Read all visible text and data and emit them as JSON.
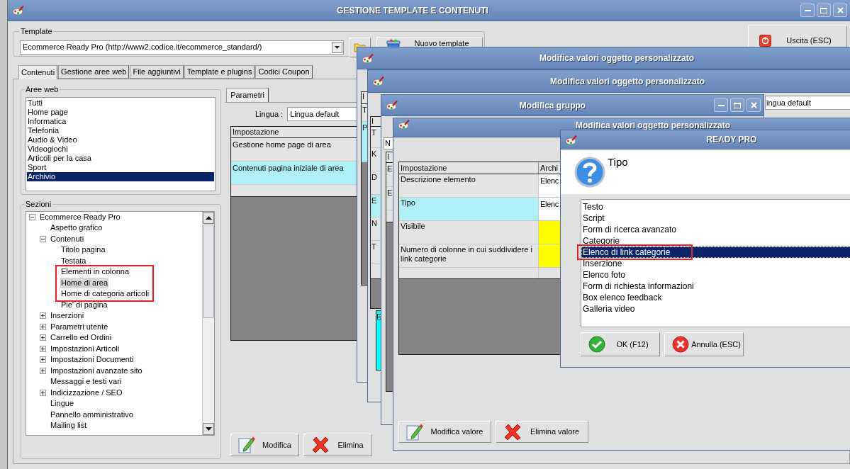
{
  "main_window": {
    "title": "GESTIONE TEMPLATE E CONTENUTI",
    "template": {
      "label": "Template",
      "value": "Ecommerce Ready Pro (http://www2.codice.it/ecommerce_standard/)"
    },
    "new_template_button": "Nuovo template",
    "exit_button": "Uscita (ESC)",
    "tabs": [
      {
        "label": "Contenuti",
        "selected": true
      },
      {
        "label": "Gestione aree web",
        "selected": false
      },
      {
        "label": "File aggiuntivi",
        "selected": false
      },
      {
        "label": "Template e plugins",
        "selected": false
      },
      {
        "label": "Codici Coupon",
        "selected": false
      }
    ],
    "aree_web": {
      "label": "Aree web",
      "items": [
        {
          "label": "Tutti",
          "selected": false
        },
        {
          "label": "Home page",
          "selected": false
        },
        {
          "label": "Informatica",
          "selected": false
        },
        {
          "label": "Telefonia",
          "selected": false
        },
        {
          "label": "Audio & Video",
          "selected": false
        },
        {
          "label": "Videogiochi",
          "selected": false
        },
        {
          "label": "Articoli per la casa",
          "selected": false
        },
        {
          "label": "Sport",
          "selected": false
        },
        {
          "label": "Archivio",
          "selected": true
        }
      ]
    },
    "sezioni": {
      "label": "Sezioni",
      "tree": [
        {
          "label": "Ecommerce Ready Pro",
          "expanded": true,
          "selected": false,
          "children": [
            {
              "label": "Aspetto grafico",
              "selected": false
            },
            {
              "label": "Contenuti",
              "expanded": true,
              "selected": false,
              "children": [
                {
                  "label": "Titolo pagina",
                  "selected": false
                },
                {
                  "label": "Testata",
                  "selected": false
                },
                {
                  "label": "Elementi in colonna",
                  "selected": false,
                  "marked": true
                },
                {
                  "label": "Home di area",
                  "selected": true,
                  "marked": true
                },
                {
                  "label": "Home di categoria articoli",
                  "selected": false,
                  "marked": true
                },
                {
                  "label": "Pie' di pagina",
                  "selected": false
                }
              ]
            },
            {
              "label": "Inserzioni",
              "expanded": false,
              "selected": false
            },
            {
              "label": "Parametri utente",
              "expanded": false,
              "selected": false
            },
            {
              "label": "Carrello ed Ordini",
              "expanded": false,
              "selected": false
            },
            {
              "label": "Impostazioni Articoli",
              "expanded": false,
              "selected": false
            },
            {
              "label": "Impostazioni Documenti",
              "expanded": false,
              "selected": false
            },
            {
              "label": "Impostazioni avanzate sito",
              "expanded": false,
              "selected": false
            },
            {
              "label": "Messaggi e testi vari",
              "selected": false
            },
            {
              "label": "Indicizzazione / SEO",
              "expanded": false,
              "selected": false
            },
            {
              "label": "Lingue",
              "selected": false
            },
            {
              "label": "Pannello amministrativo",
              "selected": false
            },
            {
              "label": "Mailing list",
              "selected": false
            }
          ]
        }
      ]
    },
    "parametri": {
      "tab": "Parametri",
      "lingua_label": "Lingua :",
      "lingua_value": "Lingua default",
      "column": "Impostazione",
      "rows": [
        {
          "label": "Gestione home page di area",
          "selected": false
        },
        {
          "label": "Contenuti pagina iniziale di area",
          "selected": true
        }
      ]
    },
    "buttons": [
      {
        "label": "Modifica",
        "kind": "edit"
      },
      {
        "label": "Elimina",
        "kind": "delete"
      }
    ]
  },
  "windows": [
    {
      "kind": "peek",
      "title": "Modifica valori oggetto personalizzato",
      "header": "I",
      "rows": [
        {
          "text": "T",
          "selected": false
        },
        {
          "text": "P",
          "selected": true
        }
      ]
    },
    {
      "kind": "peek",
      "title": "Modifica valori oggetto personalizzato",
      "lingua_value": "ingua default",
      "header": "I",
      "rows": [
        {
          "text": "T",
          "selected": false
        },
        {
          "text": "K",
          "selected": false
        },
        {
          "text": "D",
          "selected": false
        },
        {
          "text": "E",
          "selected": true
        },
        {
          "text": "N",
          "selected": false
        },
        {
          "text": "T",
          "selected": false
        }
      ],
      "lower_rows": [
        {
          "text": "E",
          "selected": true
        }
      ]
    },
    {
      "kind": "peek",
      "title": "Modifica gruppo",
      "field_value": "N",
      "header": "I",
      "rows": [
        {
          "text": "E",
          "selected": false
        },
        {
          "text": "E",
          "selected": false
        }
      ]
    },
    {
      "kind": "grid",
      "title": "Modifica valori oggetto personalizzato",
      "columns": [
        "Impostazione",
        "Archi"
      ],
      "rows": [
        {
          "label": "Descrizione elemento",
          "value": "Elenc",
          "color": "#ffffff",
          "selected": false
        },
        {
          "label": "Tipo",
          "value": "Elenc",
          "color": "#ffffff",
          "selected": true
        },
        {
          "label": "Visibile",
          "color": "#ffff00",
          "selected": false
        },
        {
          "label": "Numero di colonne in cui suddividere i link categorie",
          "color": "#ffff00",
          "selected": false
        }
      ],
      "buttons": [
        {
          "label": "Modifica valore",
          "kind": "edit"
        },
        {
          "label": "Elimina valore",
          "kind": "delete"
        }
      ]
    }
  ],
  "dialog": {
    "title": "READY PRO",
    "prompt": "Tipo",
    "items": [
      {
        "label": "Testo",
        "selected": false
      },
      {
        "label": "Script",
        "selected": false
      },
      {
        "label": "Form di ricerca avanzato",
        "selected": false
      },
      {
        "label": "Categorie",
        "selected": false
      },
      {
        "label": "Elenco di link categorie",
        "selected": true,
        "marked": true
      },
      {
        "label": "Inserzione",
        "selected": false
      },
      {
        "label": "Elenco foto",
        "selected": false
      },
      {
        "label": "Form di richiesta informazioni",
        "selected": false
      },
      {
        "label": "Box elenco feedback",
        "selected": false
      },
      {
        "label": "Galleria video",
        "selected": false
      }
    ],
    "buttons": [
      {
        "label": "OK (F12)",
        "kind": "ok"
      },
      {
        "label": "Annulla (ESC)",
        "kind": "cancel"
      }
    ]
  }
}
